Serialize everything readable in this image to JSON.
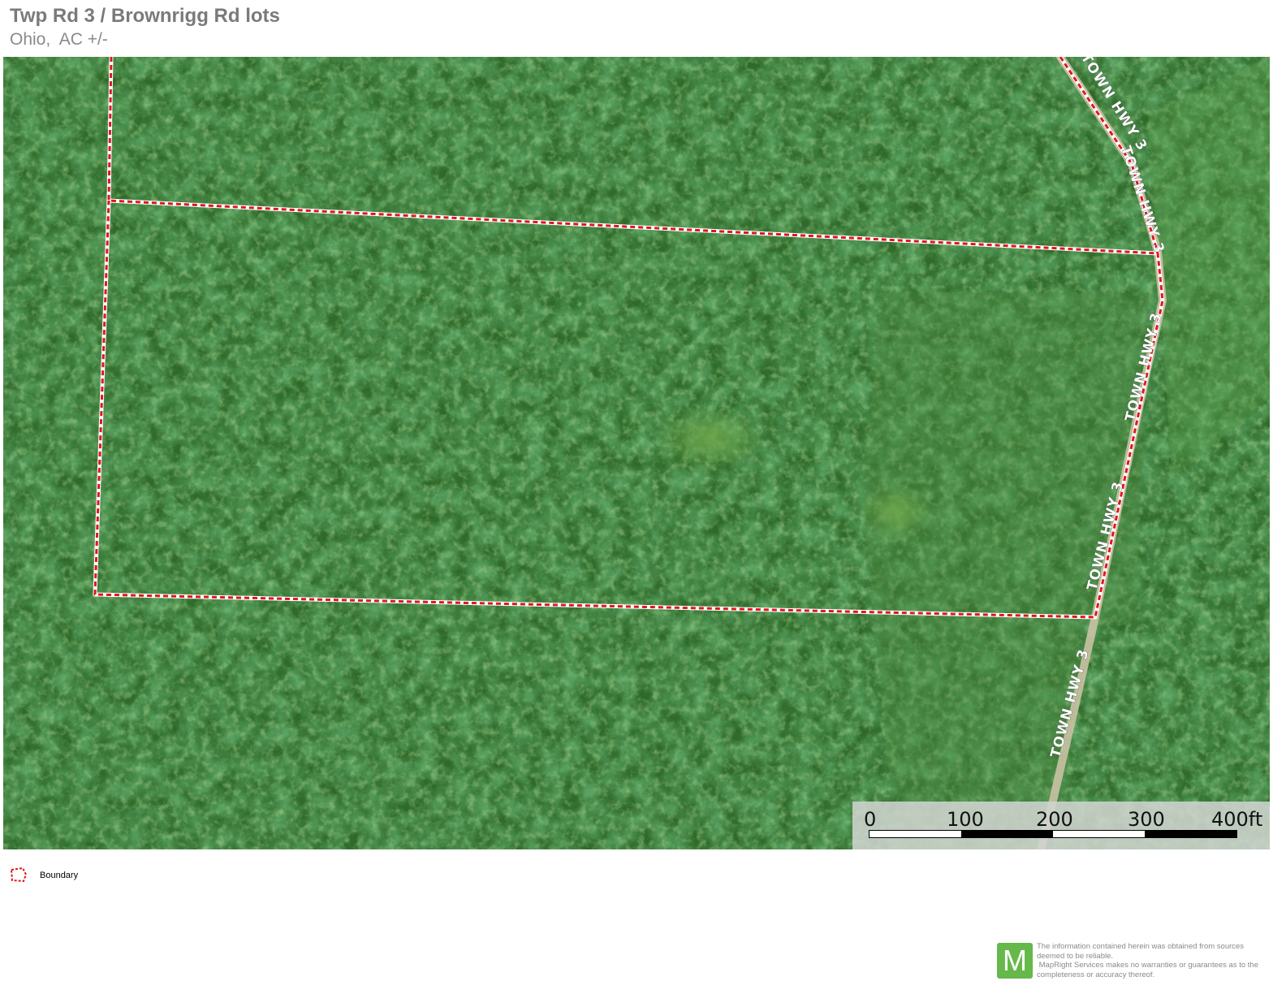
{
  "header": {
    "title": "Twp Rd 3 / Brownrigg Rd lots",
    "subtitle": "Ohio,  AC +/-"
  },
  "map": {
    "road_labels": [
      "TOWN HWY 3",
      "TOWN HWY 3",
      "TOWN HWY 3",
      "TOWN HWY 3",
      "TOWN HWY 3"
    ],
    "boundary_color": "#e0161b",
    "scalebar": {
      "ticks": [
        "0",
        "100",
        "200",
        "300",
        "400ft"
      ]
    }
  },
  "legend": {
    "items": [
      {
        "label": "Boundary",
        "icon": "boundary-polygon-icon"
      }
    ]
  },
  "footer": {
    "logo_letter": "M",
    "disclaimer_lines": [
      "The information contained herein was obtained from sources",
      "deemed to be reliable.",
      " MapRight Services makes no warranties or guarantees as to the",
      "completeness or accuracy thereof."
    ]
  }
}
